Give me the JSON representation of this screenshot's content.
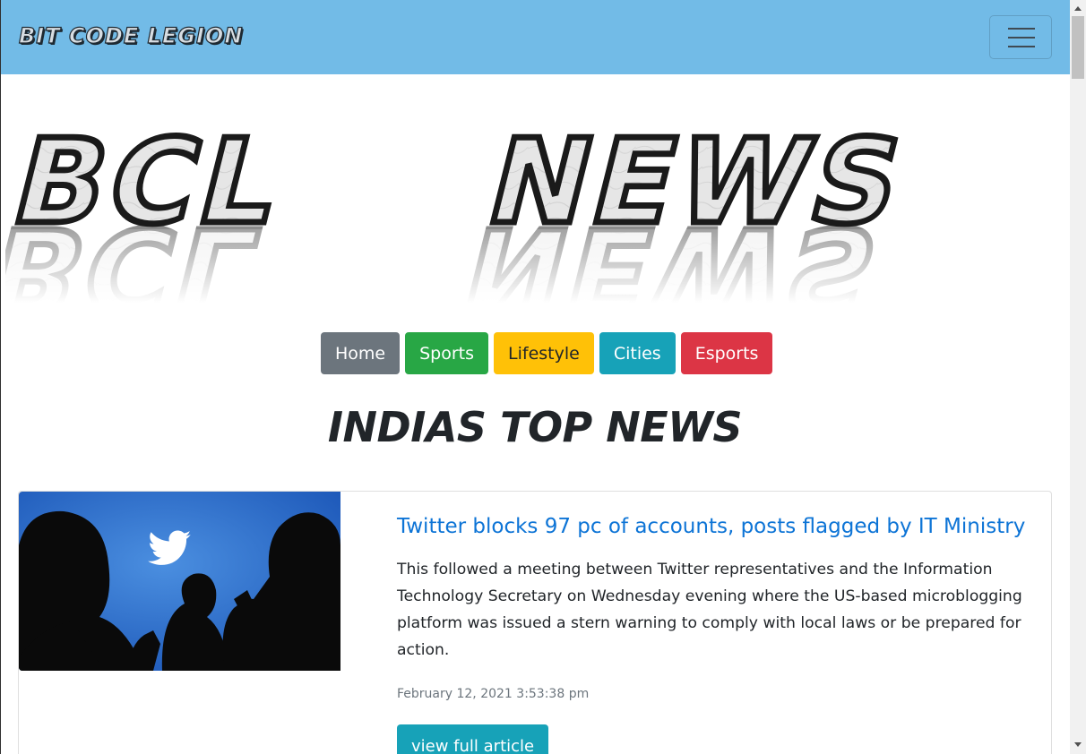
{
  "navbar": {
    "brand": "BIT CODE LEGION",
    "toggler_icon": "hamburger-icon"
  },
  "banner": {
    "logo_text": "BCL NEWS"
  },
  "categories": [
    {
      "label": "Home",
      "color": "#6c757d"
    },
    {
      "label": "Sports",
      "color": "#28a745"
    },
    {
      "label": "Lifestyle",
      "color": "#ffc107"
    },
    {
      "label": "Cities",
      "color": "#17a2b8"
    },
    {
      "label": "Esports",
      "color": "#dc3545"
    }
  ],
  "heading": "INDIAS TOP NEWS",
  "article": {
    "title": "Twitter blocks 97 pc of accounts, posts flagged by IT Ministry",
    "description": "This followed a meeting between Twitter representatives and the Information Technology Secretary on Wednesday evening where the US-based microblogging platform was issued a stern warning to comply with local laws or be prepared for action.",
    "date": "February 12, 2021 3:53:38 pm",
    "button_label": "view full article"
  },
  "colors": {
    "navbar_bg": "#72bbe7",
    "link": "#0d74d6",
    "info": "#17a2b8"
  }
}
